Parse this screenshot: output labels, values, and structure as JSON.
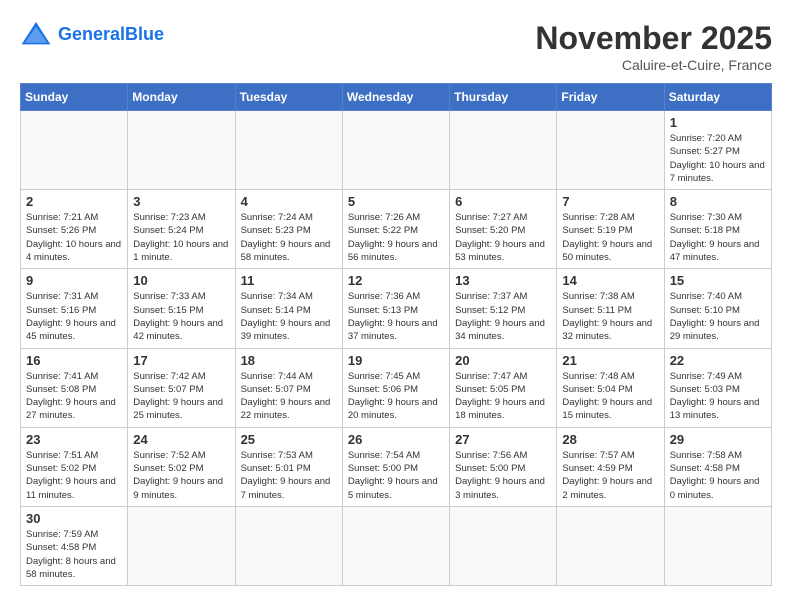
{
  "header": {
    "logo_general": "General",
    "logo_blue": "Blue",
    "month_title": "November 2025",
    "subtitle": "Caluire-et-Cuire, France"
  },
  "days_of_week": [
    "Sunday",
    "Monday",
    "Tuesday",
    "Wednesday",
    "Thursday",
    "Friday",
    "Saturday"
  ],
  "weeks": [
    [
      {
        "day": "",
        "info": ""
      },
      {
        "day": "",
        "info": ""
      },
      {
        "day": "",
        "info": ""
      },
      {
        "day": "",
        "info": ""
      },
      {
        "day": "",
        "info": ""
      },
      {
        "day": "",
        "info": ""
      },
      {
        "day": "1",
        "info": "Sunrise: 7:20 AM\nSunset: 5:27 PM\nDaylight: 10 hours and 7 minutes."
      }
    ],
    [
      {
        "day": "2",
        "info": "Sunrise: 7:21 AM\nSunset: 5:26 PM\nDaylight: 10 hours and 4 minutes."
      },
      {
        "day": "3",
        "info": "Sunrise: 7:23 AM\nSunset: 5:24 PM\nDaylight: 10 hours and 1 minute."
      },
      {
        "day": "4",
        "info": "Sunrise: 7:24 AM\nSunset: 5:23 PM\nDaylight: 9 hours and 58 minutes."
      },
      {
        "day": "5",
        "info": "Sunrise: 7:26 AM\nSunset: 5:22 PM\nDaylight: 9 hours and 56 minutes."
      },
      {
        "day": "6",
        "info": "Sunrise: 7:27 AM\nSunset: 5:20 PM\nDaylight: 9 hours and 53 minutes."
      },
      {
        "day": "7",
        "info": "Sunrise: 7:28 AM\nSunset: 5:19 PM\nDaylight: 9 hours and 50 minutes."
      },
      {
        "day": "8",
        "info": "Sunrise: 7:30 AM\nSunset: 5:18 PM\nDaylight: 9 hours and 47 minutes."
      }
    ],
    [
      {
        "day": "9",
        "info": "Sunrise: 7:31 AM\nSunset: 5:16 PM\nDaylight: 9 hours and 45 minutes."
      },
      {
        "day": "10",
        "info": "Sunrise: 7:33 AM\nSunset: 5:15 PM\nDaylight: 9 hours and 42 minutes."
      },
      {
        "day": "11",
        "info": "Sunrise: 7:34 AM\nSunset: 5:14 PM\nDaylight: 9 hours and 39 minutes."
      },
      {
        "day": "12",
        "info": "Sunrise: 7:36 AM\nSunset: 5:13 PM\nDaylight: 9 hours and 37 minutes."
      },
      {
        "day": "13",
        "info": "Sunrise: 7:37 AM\nSunset: 5:12 PM\nDaylight: 9 hours and 34 minutes."
      },
      {
        "day": "14",
        "info": "Sunrise: 7:38 AM\nSunset: 5:11 PM\nDaylight: 9 hours and 32 minutes."
      },
      {
        "day": "15",
        "info": "Sunrise: 7:40 AM\nSunset: 5:10 PM\nDaylight: 9 hours and 29 minutes."
      }
    ],
    [
      {
        "day": "16",
        "info": "Sunrise: 7:41 AM\nSunset: 5:08 PM\nDaylight: 9 hours and 27 minutes."
      },
      {
        "day": "17",
        "info": "Sunrise: 7:42 AM\nSunset: 5:07 PM\nDaylight: 9 hours and 25 minutes."
      },
      {
        "day": "18",
        "info": "Sunrise: 7:44 AM\nSunset: 5:07 PM\nDaylight: 9 hours and 22 minutes."
      },
      {
        "day": "19",
        "info": "Sunrise: 7:45 AM\nSunset: 5:06 PM\nDaylight: 9 hours and 20 minutes."
      },
      {
        "day": "20",
        "info": "Sunrise: 7:47 AM\nSunset: 5:05 PM\nDaylight: 9 hours and 18 minutes."
      },
      {
        "day": "21",
        "info": "Sunrise: 7:48 AM\nSunset: 5:04 PM\nDaylight: 9 hours and 15 minutes."
      },
      {
        "day": "22",
        "info": "Sunrise: 7:49 AM\nSunset: 5:03 PM\nDaylight: 9 hours and 13 minutes."
      }
    ],
    [
      {
        "day": "23",
        "info": "Sunrise: 7:51 AM\nSunset: 5:02 PM\nDaylight: 9 hours and 11 minutes."
      },
      {
        "day": "24",
        "info": "Sunrise: 7:52 AM\nSunset: 5:02 PM\nDaylight: 9 hours and 9 minutes."
      },
      {
        "day": "25",
        "info": "Sunrise: 7:53 AM\nSunset: 5:01 PM\nDaylight: 9 hours and 7 minutes."
      },
      {
        "day": "26",
        "info": "Sunrise: 7:54 AM\nSunset: 5:00 PM\nDaylight: 9 hours and 5 minutes."
      },
      {
        "day": "27",
        "info": "Sunrise: 7:56 AM\nSunset: 5:00 PM\nDaylight: 9 hours and 3 minutes."
      },
      {
        "day": "28",
        "info": "Sunrise: 7:57 AM\nSunset: 4:59 PM\nDaylight: 9 hours and 2 minutes."
      },
      {
        "day": "29",
        "info": "Sunrise: 7:58 AM\nSunset: 4:58 PM\nDaylight: 9 hours and 0 minutes."
      }
    ],
    [
      {
        "day": "30",
        "info": "Sunrise: 7:59 AM\nSunset: 4:58 PM\nDaylight: 8 hours and 58 minutes."
      },
      {
        "day": "",
        "info": ""
      },
      {
        "day": "",
        "info": ""
      },
      {
        "day": "",
        "info": ""
      },
      {
        "day": "",
        "info": ""
      },
      {
        "day": "",
        "info": ""
      },
      {
        "day": "",
        "info": ""
      }
    ]
  ]
}
